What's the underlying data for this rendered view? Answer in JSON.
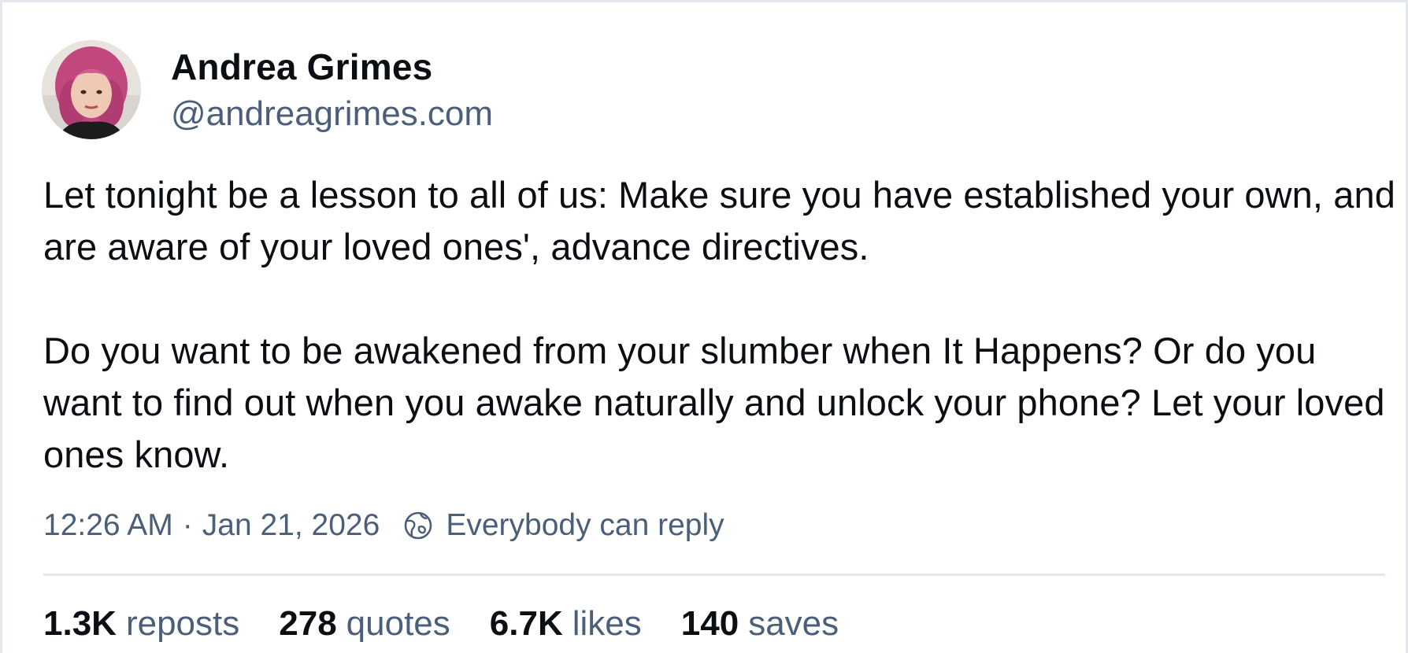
{
  "author": {
    "display_name": "Andrea Grimes",
    "handle": "@andreagrimes.com"
  },
  "post": {
    "text": "Let tonight be a lesson to all of us: Make sure you have established your own, and are aware of your loved ones', advance directives.\n\nDo you want to be awakened from your slumber when It Happens? Or do you want to find out when you awake naturally and unlock your phone? Let your loved ones know.",
    "time": "12:26 AM",
    "separator": "·",
    "date": "Jan 21, 2026",
    "reply_setting": "Everybody can reply"
  },
  "stats": {
    "reposts": {
      "count": "1.3K",
      "label": "reposts"
    },
    "quotes": {
      "count": "278",
      "label": "quotes"
    },
    "likes": {
      "count": "6.7K",
      "label": "likes"
    },
    "saves": {
      "count": "140",
      "label": "saves"
    }
  },
  "icons": {
    "reply_setting": "globe-icon"
  },
  "colors": {
    "text_primary": "#0b0f14",
    "text_secondary": "#4c5f7a",
    "border": "#e4e8ee"
  }
}
